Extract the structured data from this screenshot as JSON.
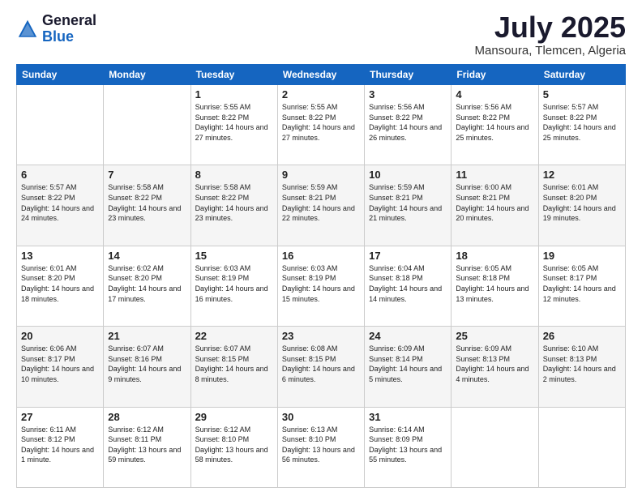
{
  "header": {
    "logo_general": "General",
    "logo_blue": "Blue",
    "title": "July 2025",
    "location": "Mansoura, Tlemcen, Algeria"
  },
  "days_of_week": [
    "Sunday",
    "Monday",
    "Tuesday",
    "Wednesday",
    "Thursday",
    "Friday",
    "Saturday"
  ],
  "weeks": [
    {
      "shaded": false,
      "days": [
        {
          "num": "",
          "info": ""
        },
        {
          "num": "",
          "info": ""
        },
        {
          "num": "1",
          "info": "Sunrise: 5:55 AM\nSunset: 8:22 PM\nDaylight: 14 hours and 27 minutes."
        },
        {
          "num": "2",
          "info": "Sunrise: 5:55 AM\nSunset: 8:22 PM\nDaylight: 14 hours and 27 minutes."
        },
        {
          "num": "3",
          "info": "Sunrise: 5:56 AM\nSunset: 8:22 PM\nDaylight: 14 hours and 26 minutes."
        },
        {
          "num": "4",
          "info": "Sunrise: 5:56 AM\nSunset: 8:22 PM\nDaylight: 14 hours and 25 minutes."
        },
        {
          "num": "5",
          "info": "Sunrise: 5:57 AM\nSunset: 8:22 PM\nDaylight: 14 hours and 25 minutes."
        }
      ]
    },
    {
      "shaded": true,
      "days": [
        {
          "num": "6",
          "info": "Sunrise: 5:57 AM\nSunset: 8:22 PM\nDaylight: 14 hours and 24 minutes."
        },
        {
          "num": "7",
          "info": "Sunrise: 5:58 AM\nSunset: 8:22 PM\nDaylight: 14 hours and 23 minutes."
        },
        {
          "num": "8",
          "info": "Sunrise: 5:58 AM\nSunset: 8:22 PM\nDaylight: 14 hours and 23 minutes."
        },
        {
          "num": "9",
          "info": "Sunrise: 5:59 AM\nSunset: 8:21 PM\nDaylight: 14 hours and 22 minutes."
        },
        {
          "num": "10",
          "info": "Sunrise: 5:59 AM\nSunset: 8:21 PM\nDaylight: 14 hours and 21 minutes."
        },
        {
          "num": "11",
          "info": "Sunrise: 6:00 AM\nSunset: 8:21 PM\nDaylight: 14 hours and 20 minutes."
        },
        {
          "num": "12",
          "info": "Sunrise: 6:01 AM\nSunset: 8:20 PM\nDaylight: 14 hours and 19 minutes."
        }
      ]
    },
    {
      "shaded": false,
      "days": [
        {
          "num": "13",
          "info": "Sunrise: 6:01 AM\nSunset: 8:20 PM\nDaylight: 14 hours and 18 minutes."
        },
        {
          "num": "14",
          "info": "Sunrise: 6:02 AM\nSunset: 8:20 PM\nDaylight: 14 hours and 17 minutes."
        },
        {
          "num": "15",
          "info": "Sunrise: 6:03 AM\nSunset: 8:19 PM\nDaylight: 14 hours and 16 minutes."
        },
        {
          "num": "16",
          "info": "Sunrise: 6:03 AM\nSunset: 8:19 PM\nDaylight: 14 hours and 15 minutes."
        },
        {
          "num": "17",
          "info": "Sunrise: 6:04 AM\nSunset: 8:18 PM\nDaylight: 14 hours and 14 minutes."
        },
        {
          "num": "18",
          "info": "Sunrise: 6:05 AM\nSunset: 8:18 PM\nDaylight: 14 hours and 13 minutes."
        },
        {
          "num": "19",
          "info": "Sunrise: 6:05 AM\nSunset: 8:17 PM\nDaylight: 14 hours and 12 minutes."
        }
      ]
    },
    {
      "shaded": true,
      "days": [
        {
          "num": "20",
          "info": "Sunrise: 6:06 AM\nSunset: 8:17 PM\nDaylight: 14 hours and 10 minutes."
        },
        {
          "num": "21",
          "info": "Sunrise: 6:07 AM\nSunset: 8:16 PM\nDaylight: 14 hours and 9 minutes."
        },
        {
          "num": "22",
          "info": "Sunrise: 6:07 AM\nSunset: 8:15 PM\nDaylight: 14 hours and 8 minutes."
        },
        {
          "num": "23",
          "info": "Sunrise: 6:08 AM\nSunset: 8:15 PM\nDaylight: 14 hours and 6 minutes."
        },
        {
          "num": "24",
          "info": "Sunrise: 6:09 AM\nSunset: 8:14 PM\nDaylight: 14 hours and 5 minutes."
        },
        {
          "num": "25",
          "info": "Sunrise: 6:09 AM\nSunset: 8:13 PM\nDaylight: 14 hours and 4 minutes."
        },
        {
          "num": "26",
          "info": "Sunrise: 6:10 AM\nSunset: 8:13 PM\nDaylight: 14 hours and 2 minutes."
        }
      ]
    },
    {
      "shaded": false,
      "days": [
        {
          "num": "27",
          "info": "Sunrise: 6:11 AM\nSunset: 8:12 PM\nDaylight: 14 hours and 1 minute."
        },
        {
          "num": "28",
          "info": "Sunrise: 6:12 AM\nSunset: 8:11 PM\nDaylight: 13 hours and 59 minutes."
        },
        {
          "num": "29",
          "info": "Sunrise: 6:12 AM\nSunset: 8:10 PM\nDaylight: 13 hours and 58 minutes."
        },
        {
          "num": "30",
          "info": "Sunrise: 6:13 AM\nSunset: 8:10 PM\nDaylight: 13 hours and 56 minutes."
        },
        {
          "num": "31",
          "info": "Sunrise: 6:14 AM\nSunset: 8:09 PM\nDaylight: 13 hours and 55 minutes."
        },
        {
          "num": "",
          "info": ""
        },
        {
          "num": "",
          "info": ""
        }
      ]
    }
  ]
}
